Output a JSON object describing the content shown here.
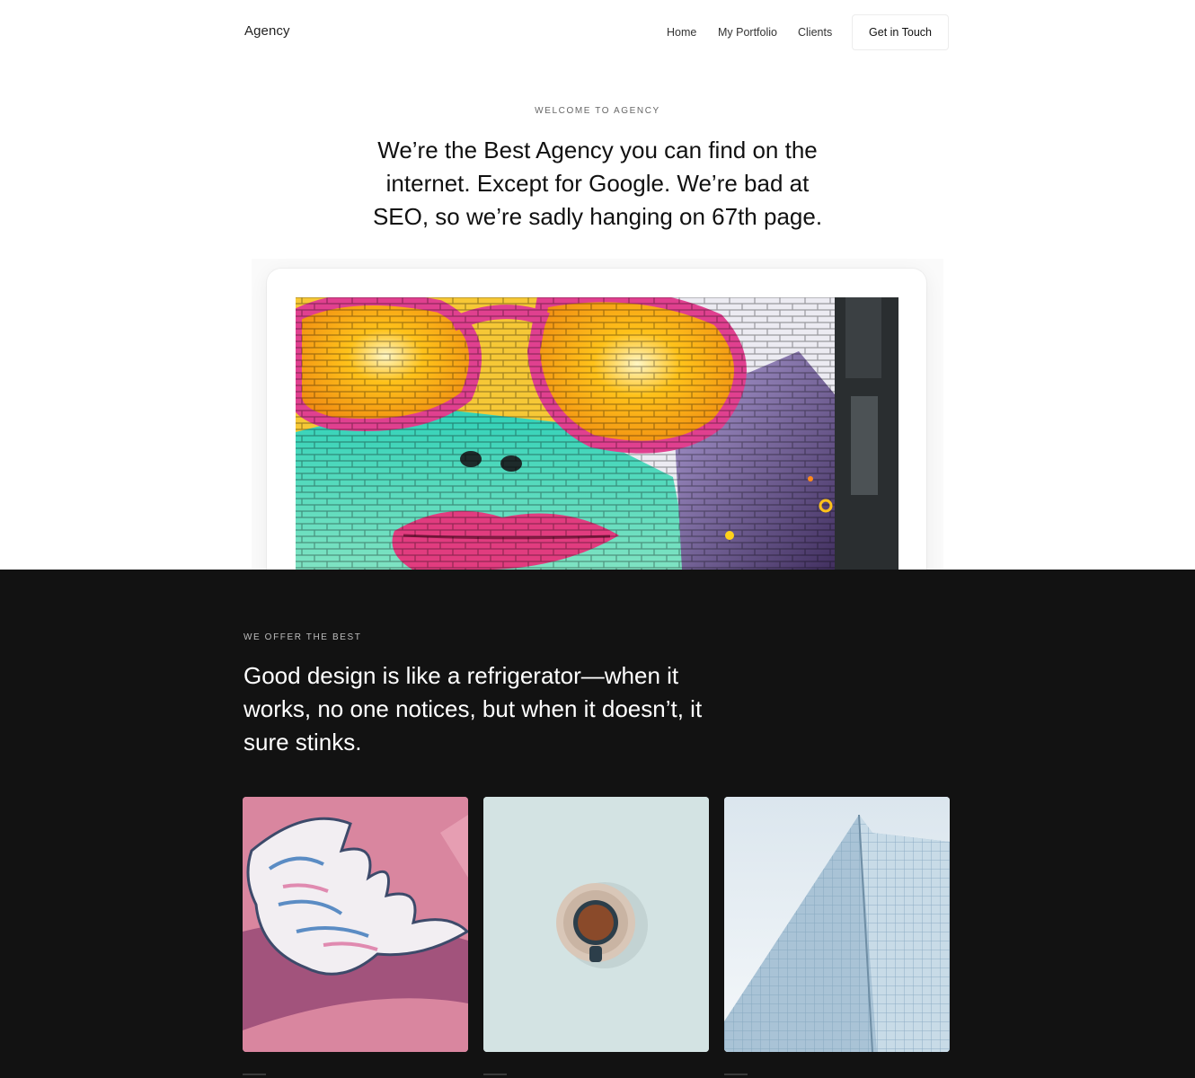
{
  "header": {
    "brand": "Agency",
    "nav": [
      {
        "label": "Home"
      },
      {
        "label": "My Portfolio"
      },
      {
        "label": "Clients"
      }
    ],
    "cta_label": "Get in Touch"
  },
  "hero": {
    "eyebrow": "WELCOME TO AGENCY",
    "headline": "We’re the Best Agency you can find on the internet. Except for Google. We’re bad at SEO, so we’re sadly hanging on 67th page."
  },
  "offer": {
    "eyebrow": "WE OFFER THE BEST",
    "headline": "Good design is like a refrigerator—when it works, no one notices, but when it doesn’t, it sure stinks."
  },
  "colors": {
    "dark_bg": "#121212",
    "page_bg": "#ffffff"
  }
}
